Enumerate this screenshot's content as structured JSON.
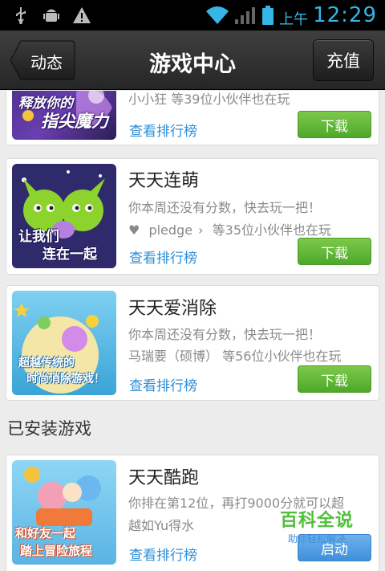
{
  "statusbar": {
    "ampm": "上午",
    "time": "12:29"
  },
  "header": {
    "title": "游戏中心",
    "back_label": "动态",
    "recharge_label": "充值"
  },
  "cards": [
    {
      "name": "",
      "line1": "",
      "line2": "小小狂 等39位小伙伴也在玩",
      "thumb_text": [
        "释放你的",
        "指尖魔力"
      ],
      "rank_label": "查看排行榜",
      "button_label": "下载"
    },
    {
      "name": "天天连萌",
      "line1": "你本周还没有分数，快去玩一把！",
      "line2_prefix": "pledge",
      "line2": "等35位小伙伴也在玩",
      "thumb_text": [
        "让我们",
        "连在一起"
      ],
      "rank_label": "查看排行榜",
      "button_label": "下载"
    },
    {
      "name": "天天爱消除",
      "line1": "你本周还没有分数，快去玩一把！",
      "line2": "马瑞要（硕博） 等56位小伙伴也在玩",
      "thumb_text": [
        "超越传统的",
        "时尚消除游戏！"
      ],
      "rank_label": "查看排行榜",
      "button_label": "下载"
    },
    {
      "name": "天天酷跑",
      "line1": "你排在第12位，再打9000分就可以超",
      "line2": "越如Yu得水",
      "thumb_text": [
        "和好友一起",
        "踏上冒险旅程"
      ],
      "rank_label": "查看排行榜",
      "button_label": "启动"
    }
  ],
  "section_installed": "已安装游戏",
  "watermark": {
    "title": "百科全说",
    "subtitle": "助你轻松解决"
  },
  "colors": {
    "accent": "#35b6e6",
    "download_green": "#5cb532",
    "link_blue": "#2e8fd8"
  }
}
